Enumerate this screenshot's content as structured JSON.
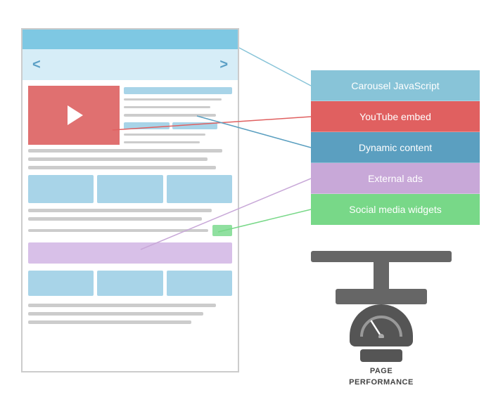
{
  "webpage": {
    "nav_left": "<",
    "nav_right": ">"
  },
  "labels": [
    {
      "id": "carousel",
      "text": "Carousel JavaScript",
      "color": "#88c4d8"
    },
    {
      "id": "youtube",
      "text": "YouTube embed",
      "color": "#e06060"
    },
    {
      "id": "dynamic",
      "text": "Dynamic content",
      "color": "#5b9fc0"
    },
    {
      "id": "ads",
      "text": "External ads",
      "color": "#c8a8d8"
    },
    {
      "id": "social",
      "text": "Social media widgets",
      "color": "#78d888"
    }
  ],
  "scale": {
    "line1": "PAGE",
    "line2": "PERFORMANCE"
  }
}
